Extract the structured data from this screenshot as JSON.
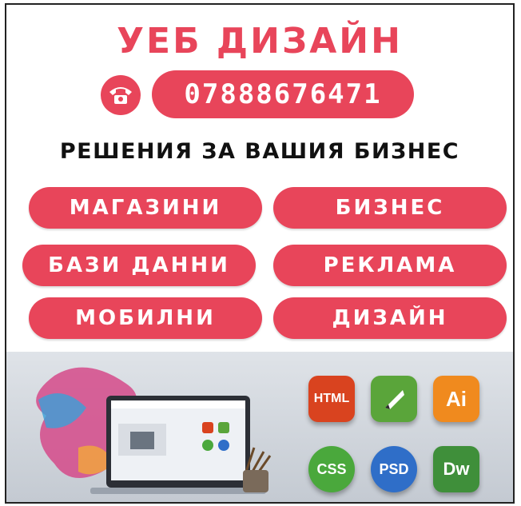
{
  "title": "УЕБ ДИЗАЙН",
  "phone": {
    "icon": "phone-icon",
    "number": "07888676471"
  },
  "tagline": "РЕШЕНИЯ ЗА ВАШИЯ БИЗНЕС",
  "services": [
    "МАГАЗИНИ",
    "БИЗНЕС",
    "БАЗИ ДАННИ",
    "РЕКЛАМА",
    "МОБИЛНИ",
    "ДИЗАЙН"
  ],
  "banner": {
    "icons": [
      {
        "label": "HTML",
        "icon": "html-icon",
        "color": "#d9431f"
      },
      {
        "label": "",
        "icon": "coreldraw-icon",
        "color": "#5aa53a"
      },
      {
        "label": "Ai",
        "icon": "illustrator-icon",
        "color": "#f08a1e"
      },
      {
        "label": "CSS",
        "icon": "css-icon",
        "color": "#4aa83c"
      },
      {
        "label": "PSD",
        "icon": "photoshop-icon",
        "color": "#2f6ec8"
      },
      {
        "label": "Dw",
        "icon": "dreamweaver-icon",
        "color": "#3f8f3a"
      }
    ]
  },
  "colors": {
    "accent": "#e8455a",
    "text": "#111111"
  }
}
